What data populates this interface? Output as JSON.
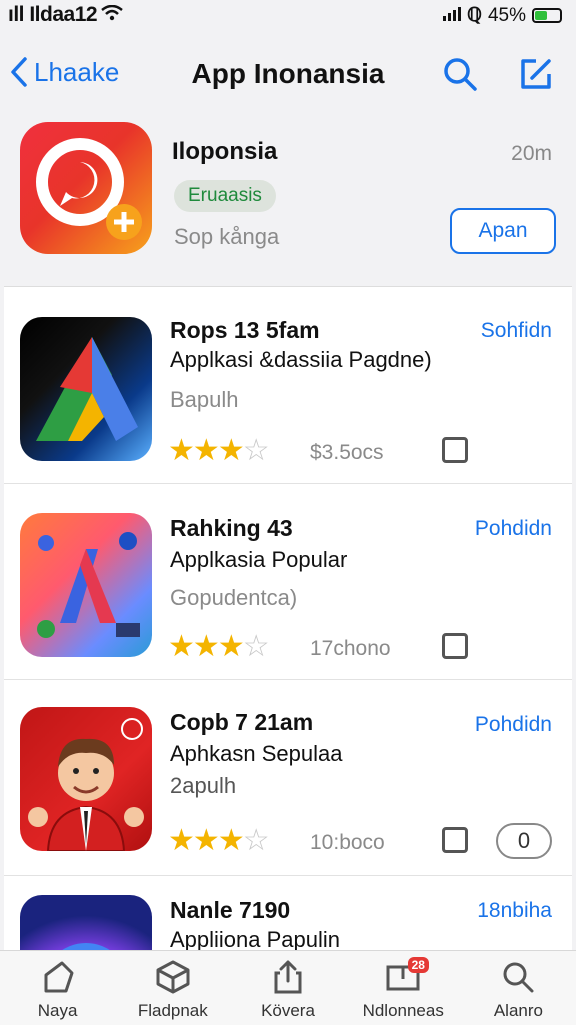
{
  "status": {
    "carrier": "ıll Ildaa12",
    "battery": "45%",
    "battery_level": 0.45
  },
  "nav": {
    "back_label": "Lhaake",
    "title": "App Inonansia"
  },
  "featured": {
    "name": "Iloponsia",
    "size": "20m",
    "badge": "Eruaasis",
    "subtitle": "Sop kånga",
    "open_label": "Apan"
  },
  "apps": [
    {
      "title": "Rops 13 5fam",
      "link": "Sohfidn",
      "subtitle": "Applkasi &dassiia Pagdne)",
      "category": "Bapulh",
      "rating": 3,
      "count": "$3.5ocs",
      "checked": false
    },
    {
      "title": "Rahking 43",
      "link": "Pohdidn",
      "subtitle": "Applkasia Popular",
      "category": "Gopudentca)",
      "rating": 3,
      "count": "17chono",
      "checked": false
    },
    {
      "title": "Copb 7 21am",
      "link": "Pohdidn",
      "subtitle": "Aphkasn Sepulaa",
      "category": "2apulh",
      "rating": 3,
      "count": "10:boco",
      "checked": false,
      "toggle": "0"
    },
    {
      "title": "Nanle 7190",
      "link": "18nbiha",
      "subtitle": "Appliiona Papulin"
    }
  ],
  "tabs": [
    {
      "label": "Naya",
      "icon": "home-icon"
    },
    {
      "label": "Fladpnak",
      "icon": "cube-icon"
    },
    {
      "label": "Kövera",
      "icon": "share-icon"
    },
    {
      "label": "Ndlonneas",
      "icon": "updates-icon",
      "badge": "28"
    },
    {
      "label": "Alanro",
      "icon": "search-icon"
    }
  ],
  "colors": {
    "accent": "#1a73e8",
    "star": "#f4b400",
    "badge_green": "#1f8a3c"
  }
}
